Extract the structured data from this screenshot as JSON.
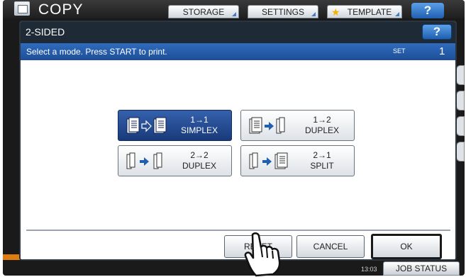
{
  "app": {
    "title": "COPY",
    "tabs": [
      {
        "label": "STORAGE"
      },
      {
        "label": "SETTINGS"
      },
      {
        "label": "TEMPLATE"
      }
    ],
    "help_label": "?",
    "job_status_label": "JOB STATUS",
    "clock": "13:03"
  },
  "dialog": {
    "title": "2-SIDED",
    "help_label": "?",
    "message": "Select a mode. Press START to print.",
    "set_label": "SET",
    "set_value": "1",
    "modes": [
      {
        "line1": "1→1",
        "line2": "SIMPLEX",
        "selected": true,
        "icon": "simplex-icon"
      },
      {
        "line1": "1→2",
        "line2": "DUPLEX",
        "selected": false,
        "icon": "duplex-1-to-2-icon"
      },
      {
        "line1": "2→2",
        "line2": "DUPLEX",
        "selected": false,
        "icon": "duplex-2-to-2-icon"
      },
      {
        "line1": "2→1",
        "line2": "SPLIT",
        "selected": false,
        "icon": "split-icon"
      }
    ],
    "buttons": {
      "reset": "RESET",
      "cancel": "CANCEL",
      "ok": "OK"
    }
  },
  "colors": {
    "selected_mode": "#1f4a94",
    "message_bar": "#2a62b0",
    "dialog_header": "#1e2a36",
    "accent_orange": "#e07d10"
  }
}
